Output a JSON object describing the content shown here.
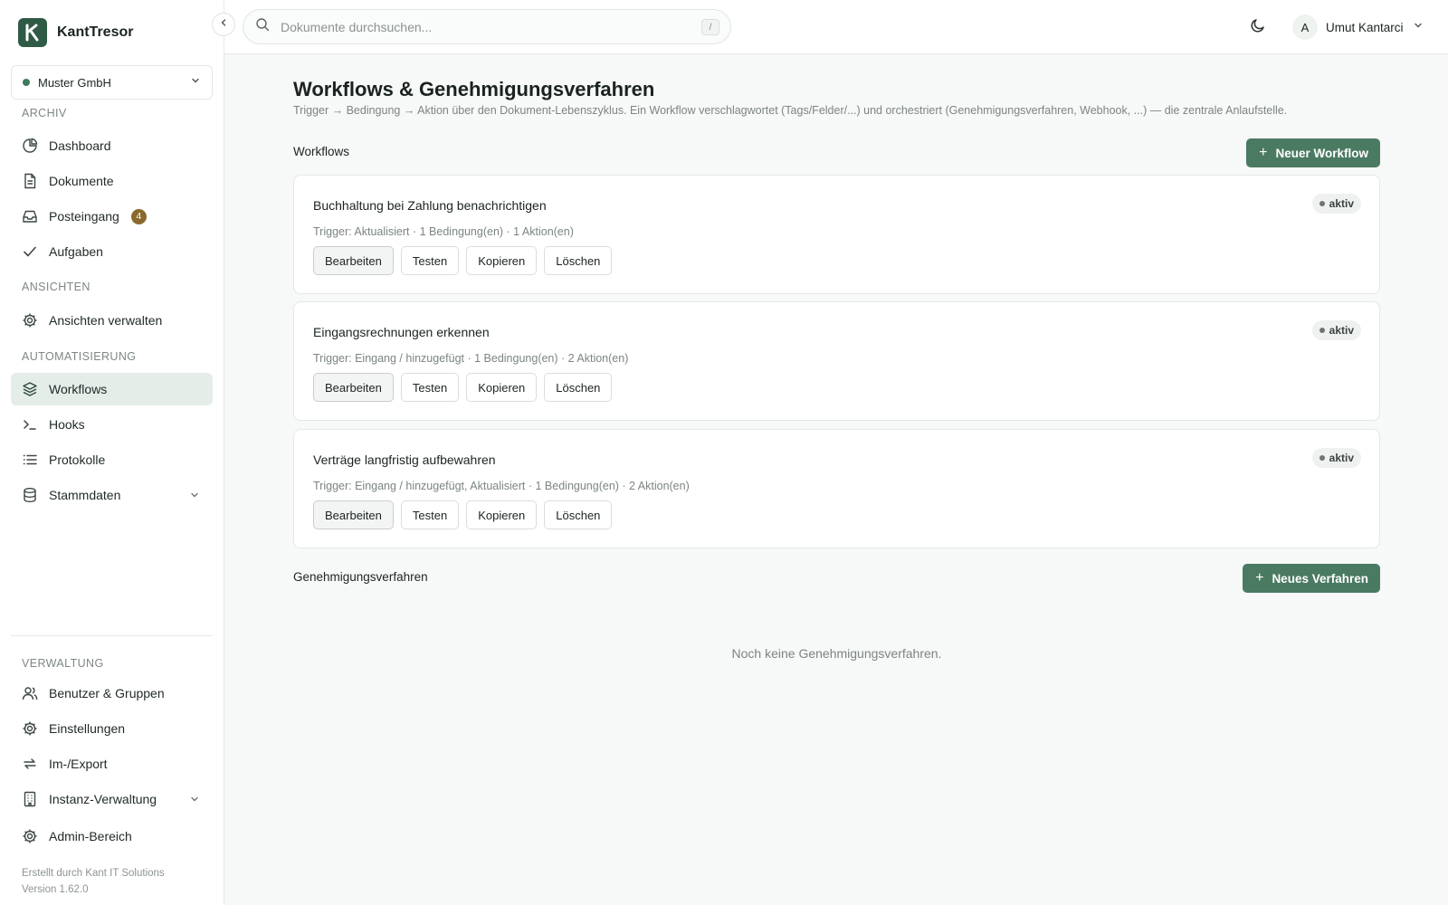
{
  "app": {
    "name": "KantTresor",
    "logo_letter": "K"
  },
  "org": {
    "name": "Muster GmbH"
  },
  "sidebar": {
    "sections": {
      "archiv": "ARCHIV",
      "ansichten": "ANSICHTEN",
      "automatisierung": "AUTOMATISIERUNG",
      "verwaltung": "VERWALTUNG"
    },
    "archiv_items": [
      {
        "label": "Dashboard",
        "icon": "pie-chart-icon"
      },
      {
        "label": "Dokumente",
        "icon": "file-text-icon"
      },
      {
        "label": "Posteingang",
        "icon": "inbox-icon",
        "badge": "4"
      },
      {
        "label": "Aufgaben",
        "icon": "check-icon"
      }
    ],
    "ansichten_items": [
      {
        "label": "Ansichten verwalten",
        "icon": "gear-icon"
      }
    ],
    "automatisierung_items": [
      {
        "label": "Workflows",
        "icon": "layers-icon",
        "active": true
      },
      {
        "label": "Hooks",
        "icon": "terminal-icon"
      },
      {
        "label": "Protokolle",
        "icon": "list-icon"
      },
      {
        "label": "Stammdaten",
        "icon": "database-icon",
        "expandable": true
      }
    ],
    "verwaltung_items": [
      {
        "label": "Benutzer & Gruppen",
        "icon": "users-icon"
      },
      {
        "label": "Einstellungen",
        "icon": "gear-icon"
      },
      {
        "label": "Im-/Export",
        "icon": "arrows-swap-icon"
      },
      {
        "label": "Instanz-Verwaltung",
        "icon": "building-icon",
        "expandable": true
      },
      {
        "label": "Admin-Bereich",
        "icon": "gear-icon"
      }
    ],
    "footer": {
      "credit": "Erstellt durch Kant IT Solutions",
      "version": "Version 1.62.0"
    }
  },
  "search": {
    "placeholder": "Dokumente durchsuchen...",
    "shortcut": "/"
  },
  "user": {
    "initial": "A",
    "name": "Umut Kantarci"
  },
  "page": {
    "title": "Workflows & Genehmigungsverfahren",
    "subtitle": "Trigger → Bedingung → Aktion über den Dokument-Lebenszyklus. Ein Workflow verschlagwortet (Tags/Felder/...) und orchestriert (Genehmigungsverfahren, Webhook, ...) — die zentrale Anlaufstelle."
  },
  "workflows": {
    "heading": "Workflows",
    "new_button": "Neuer Workflow",
    "button_labels": {
      "edit": "Bearbeiten",
      "test": "Testen",
      "copy": "Kopieren",
      "delete": "Löschen"
    },
    "items": [
      {
        "title": "Buchhaltung bei Zahlung benachrichtigen",
        "meta": "Trigger: Aktualisiert · 1 Bedingung(en) · 1 Aktion(en)",
        "status": "aktiv"
      },
      {
        "title": "Eingangsrechnungen erkennen",
        "meta": "Trigger: Eingang / hinzugefügt · 1 Bedingung(en) · 2 Aktion(en)",
        "status": "aktiv"
      },
      {
        "title": "Verträge langfristig aufbewahren",
        "meta": "Trigger: Eingang / hinzugefügt, Aktualisiert · 1 Bedingung(en) · 2 Aktion(en)",
        "status": "aktiv"
      }
    ]
  },
  "approvals": {
    "heading": "Genehmigungsverfahren",
    "new_button": "Neues Verfahren",
    "empty_text": "Noch keine Genehmigungsverfahren."
  },
  "colors": {
    "accent": "#4a7a62",
    "active_nav_bg": "#e4ede8",
    "badge": "#8a6a2c",
    "logo_bg": "#2f5a45"
  }
}
